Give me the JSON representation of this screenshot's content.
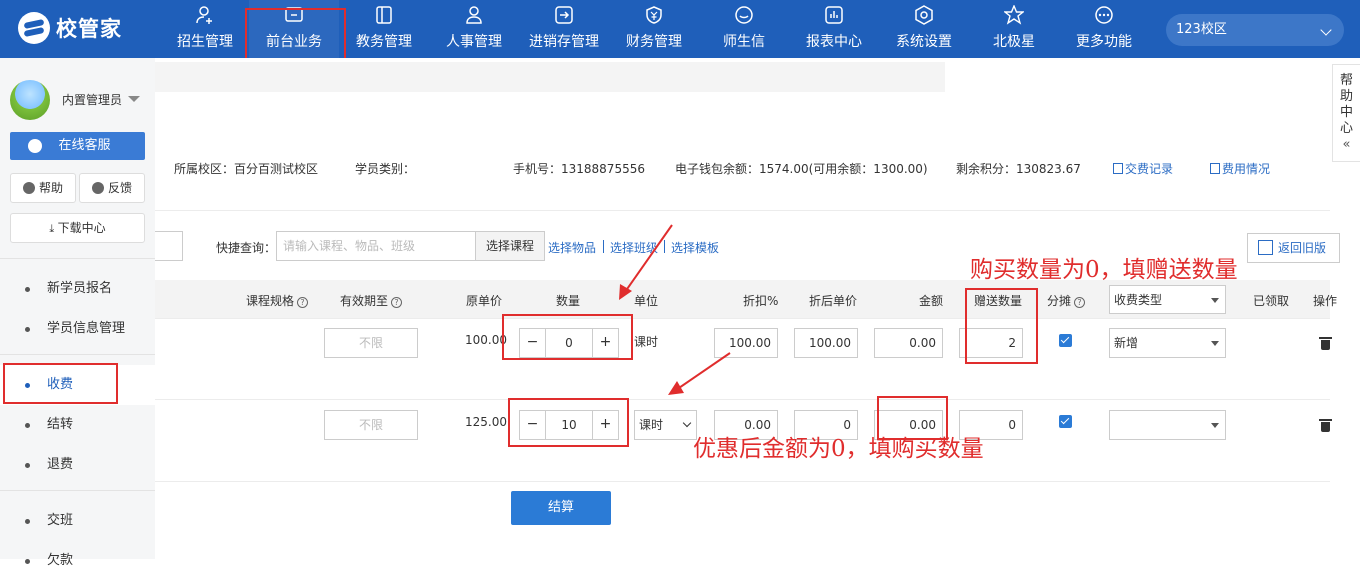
{
  "app": {
    "name": "校管家"
  },
  "nav": [
    {
      "label": "招生管理",
      "icon": "user-add-icon"
    },
    {
      "label": "前台业务",
      "icon": "reception-icon",
      "active": true
    },
    {
      "label": "教务管理",
      "icon": "book-icon"
    },
    {
      "label": "人事管理",
      "icon": "person-icon"
    },
    {
      "label": "进销存管理",
      "icon": "inventory-icon"
    },
    {
      "label": "财务管理",
      "icon": "yen-shield-icon"
    },
    {
      "label": "师生信",
      "icon": "chat-icon"
    },
    {
      "label": "报表中心",
      "icon": "report-icon"
    },
    {
      "label": "系统设置",
      "icon": "settings-icon"
    },
    {
      "label": "北极星",
      "icon": "star-icon"
    },
    {
      "label": "更多功能",
      "icon": "more-icon"
    }
  ],
  "campus_selector": "123校区",
  "sidebar": {
    "admin_name": "内置管理员",
    "online_service": "在线客服",
    "help": "帮助",
    "feedback": "反馈",
    "download_center": "下载中心",
    "menu": [
      {
        "label": "新学员报名"
      },
      {
        "label": "学员信息管理"
      },
      {
        "label": "收费",
        "active": true
      },
      {
        "label": "结转"
      },
      {
        "label": "退费"
      },
      {
        "label": "交班"
      },
      {
        "label": "欠款"
      }
    ]
  },
  "help_center": [
    "帮",
    "助",
    "中",
    "心",
    "«"
  ],
  "student_info": {
    "campus": "所属校区：百分百测试校区",
    "category": "学员类别：",
    "phone": "手机号：13188875556",
    "wallet": "电子钱包余额：1574.00(可用余额：1300.00)",
    "points": "剩余积分：130823.67",
    "payment_records": "交费记录",
    "usage": "费用情况"
  },
  "quick_search": {
    "label": "快捷查询：",
    "placeholder": "请输入课程、物品、班级",
    "button": "选择课程",
    "links": [
      "选择物品",
      "选择班级",
      "选择模板"
    ]
  },
  "back_old_version": "返回旧版",
  "annotations": {
    "top": "购买数量为0，填赠送数量",
    "bottom": "优惠后金额为0，填购买数量"
  },
  "table": {
    "headers": [
      "课程规格",
      "有效期至",
      "原单价",
      "数量",
      "单位",
      "折扣%",
      "折后单价",
      "金额",
      "赠送数量",
      "分摊",
      "已领取",
      "操作"
    ],
    "fee_type_header": "收费类型",
    "rows": [
      {
        "valid_until": "不限",
        "unit_price": "100.00",
        "quantity": "0",
        "unit": "课时",
        "discount": "100.00",
        "discounted_price": "100.00",
        "amount": "0.00",
        "gift_qty": "2",
        "fee_type": "新增"
      },
      {
        "valid_until": "不限",
        "unit_price": "125.00",
        "quantity": "10",
        "unit": "课时",
        "discount": "0.00",
        "discounted_price": "0",
        "amount": "0.00",
        "gift_qty": "0",
        "fee_type": ""
      }
    ]
  },
  "settle_button": "结算",
  "colors": {
    "nav_bg": "#1f5fba",
    "primary": "#2b7bd6",
    "annotation": "#e02d2d"
  }
}
